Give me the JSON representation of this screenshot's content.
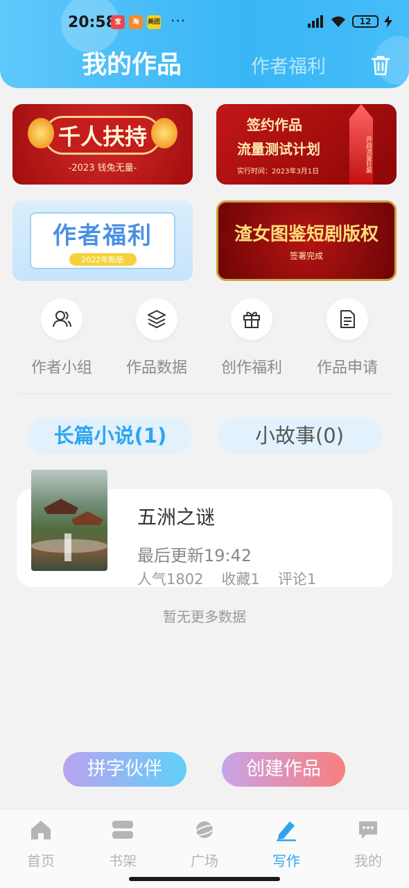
{
  "status": {
    "time": "20:58",
    "app_icons": [
      "宝",
      "淘",
      "美团"
    ],
    "more": "···",
    "battery": "12"
  },
  "header": {
    "title": "我的作品",
    "welfare_tab": "作者福利",
    "trash_icon": "trash-icon"
  },
  "banners": {
    "b1": {
      "title": "千人扶持",
      "subtitle": "-2023 钱兔无量-"
    },
    "b2": {
      "line1": "签约作品",
      "line2": "流量测试计划",
      "line3": "实行时间：2023年3月1日",
      "rocket": "开启流量狂飙"
    },
    "b3": {
      "title": "作者福利",
      "badge": "2022年新版"
    },
    "b4": {
      "title": "渣女图鉴短剧版权",
      "subtitle": "签署完成"
    }
  },
  "quick_actions": [
    {
      "label": "作者小组",
      "icon": "users-icon"
    },
    {
      "label": "作品数据",
      "icon": "layers-icon"
    },
    {
      "label": "创作福利",
      "icon": "gift-icon"
    },
    {
      "label": "作品申请",
      "icon": "document-icon"
    }
  ],
  "tabs": {
    "novel": "长篇小说(1)",
    "story": "小故事(0)"
  },
  "work": {
    "title": "五洲之谜",
    "last_update": "最后更新19:42",
    "popularity": "人气1802",
    "favorites": "收藏1",
    "comments": "评论1"
  },
  "no_more": "暂无更多数据",
  "buttons": {
    "partner": "拼字伙伴",
    "create": "创建作品"
  },
  "tabbar": [
    {
      "label": "首页",
      "icon": "home-icon"
    },
    {
      "label": "书架",
      "icon": "bookshelf-icon"
    },
    {
      "label": "广场",
      "icon": "planet-icon"
    },
    {
      "label": "写作",
      "icon": "pen-icon",
      "active": true
    },
    {
      "label": "我的",
      "icon": "chat-icon"
    }
  ],
  "colors": {
    "accent": "#2ea4f0",
    "header_blue": "#39b6f5",
    "inactive": "#b5b5b5"
  }
}
